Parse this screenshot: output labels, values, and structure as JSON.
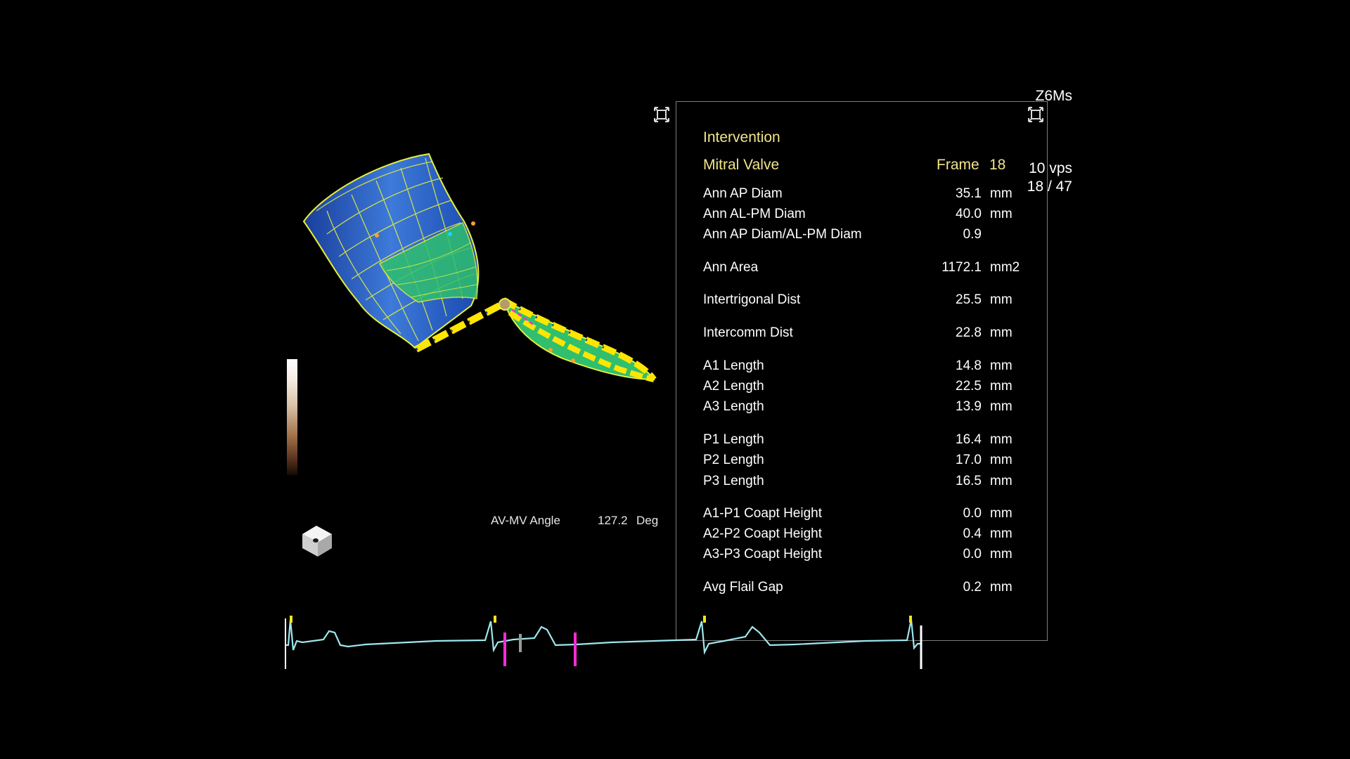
{
  "probe": "Z6Ms",
  "rate": "10 vps",
  "frame_counter": "18 / 47",
  "panel": {
    "mode": "Intervention",
    "valve": "Mitral Valve",
    "frame_label": "Frame",
    "frame_number": "18",
    "rows": [
      {
        "label": "Ann AP Diam",
        "value": "35.1",
        "unit": "mm"
      },
      {
        "label": "Ann AL-PM Diam",
        "value": "40.0",
        "unit": "mm"
      },
      {
        "label": "Ann AP Diam/AL-PM Diam",
        "value": "0.9",
        "unit": ""
      },
      {
        "label": "Ann Area",
        "value": "1172.1",
        "unit": "mm2"
      },
      {
        "label": "Intertrigonal Dist",
        "value": "25.5",
        "unit": "mm"
      },
      {
        "label": "Intercomm Dist",
        "value": "22.8",
        "unit": "mm"
      },
      {
        "label": "A1 Length",
        "value": "14.8",
        "unit": "mm"
      },
      {
        "label": "A2 Length",
        "value": "22.5",
        "unit": "mm"
      },
      {
        "label": "A3 Length",
        "value": "13.9",
        "unit": "mm"
      },
      {
        "label": "P1 Length",
        "value": "16.4",
        "unit": "mm"
      },
      {
        "label": "P2 Length",
        "value": "17.0",
        "unit": "mm"
      },
      {
        "label": "P3 Length",
        "value": "16.5",
        "unit": "mm"
      },
      {
        "label": "A1-P1 Coapt Height",
        "value": "0.0",
        "unit": "mm"
      },
      {
        "label": "A2-P2 Coapt Height",
        "value": "0.4",
        "unit": "mm"
      },
      {
        "label": "A3-P3 Coapt Height",
        "value": "0.0",
        "unit": "mm"
      },
      {
        "label": "Avg Flail Gap",
        "value": "0.2",
        "unit": "mm"
      }
    ]
  },
  "angle": {
    "label": "AV-MV Angle",
    "value": "127.2",
    "unit": "Deg"
  },
  "colors": {
    "panel_title": "#f2e58a",
    "ecg": "#9ee7ee",
    "marker": "#ff2bd6",
    "mesh": "#e6f03a",
    "surface": "#1f55b8"
  },
  "icons": {
    "expand": "expand-corners-icon",
    "orientation": "orientation-cube-icon"
  }
}
